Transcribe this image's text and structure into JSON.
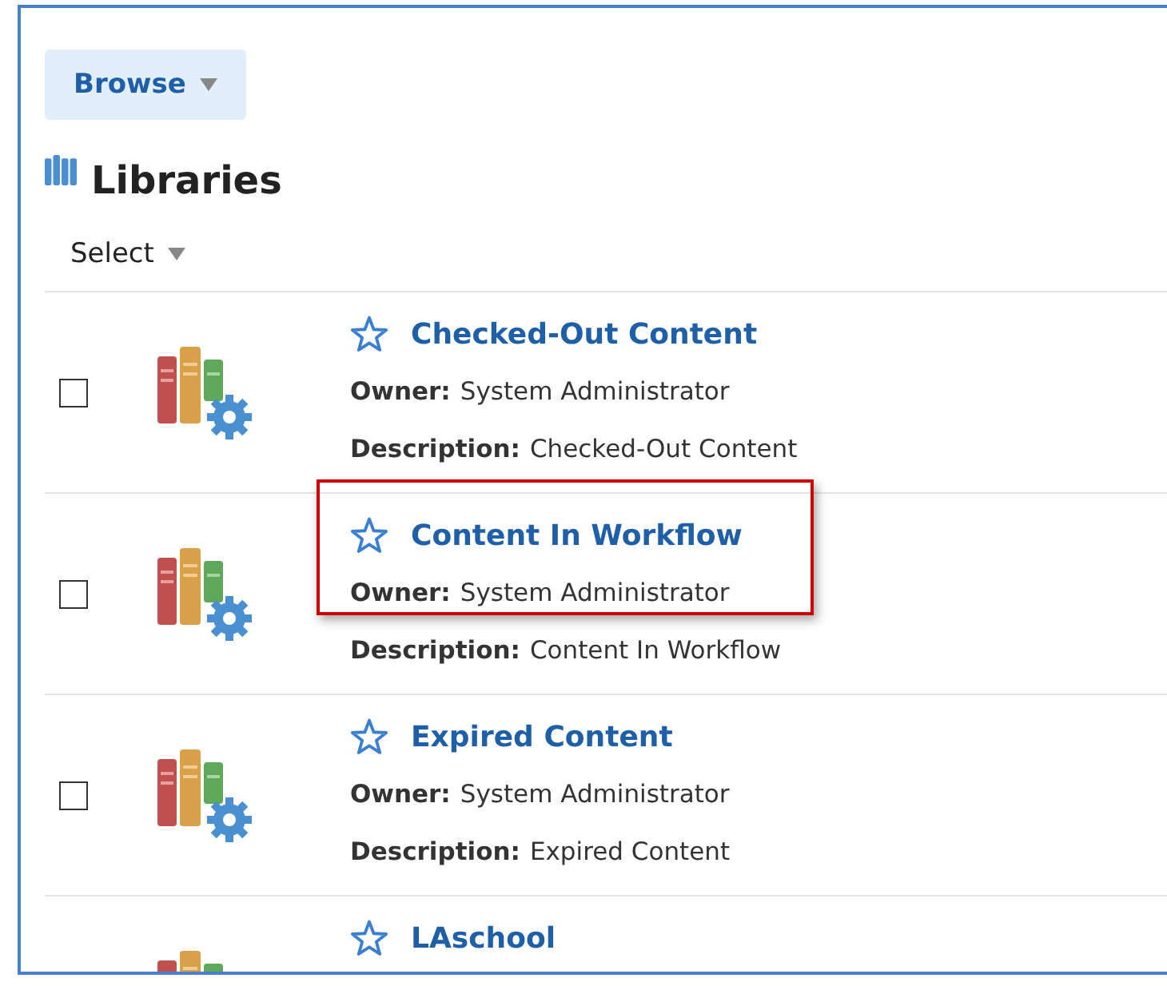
{
  "browse_button": {
    "label": "Browse"
  },
  "heading": "Libraries",
  "select_menu": {
    "label": "Select"
  },
  "libraries": [
    {
      "title": "Checked-Out Content",
      "checked": false,
      "highlighted": false,
      "owner_label": "Owner:",
      "owner": "System Administrator",
      "description_label": "Description:",
      "description": "Checked-Out Content"
    },
    {
      "title": "Content In Workflow",
      "checked": false,
      "highlighted": true,
      "owner_label": "Owner:",
      "owner": "System Administrator",
      "description_label": "Description:",
      "description": "Content In Workflow"
    },
    {
      "title": "Expired Content",
      "checked": false,
      "highlighted": false,
      "owner_label": "Owner:",
      "owner": "System Administrator",
      "description_label": "Description:",
      "description": "Expired Content"
    },
    {
      "title": "LAschool"
    }
  ]
}
